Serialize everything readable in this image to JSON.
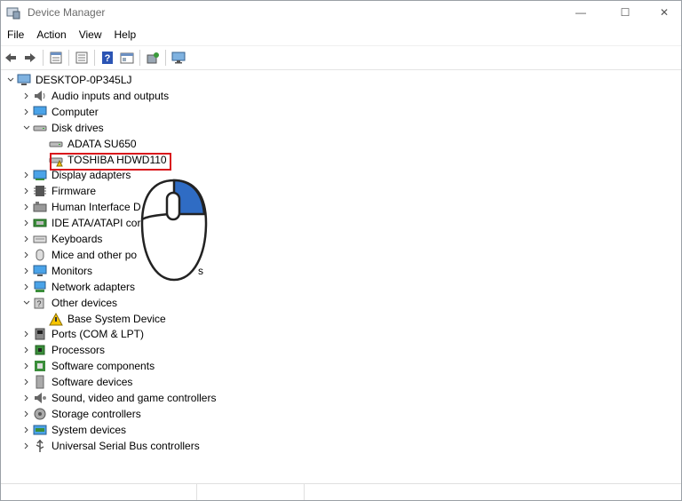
{
  "window": {
    "title": "Device Manager",
    "controls": {
      "minimize": "—",
      "maximize": "☐",
      "close": "✕"
    }
  },
  "menu": [
    {
      "label": "File"
    },
    {
      "label": "Action"
    },
    {
      "label": "View"
    },
    {
      "label": "Help"
    }
  ],
  "toolbar": {
    "buttons": [
      "back-icon",
      "forward-icon",
      "properties-icon",
      "view-icon",
      "help-icon",
      "view-resources-icon",
      "scan-hardware-icon",
      "monitor-icon"
    ]
  },
  "tree": {
    "root": "DESKTOP-0P345LJ",
    "items": [
      {
        "label": "Audio inputs and outputs",
        "icon": "speaker-icon"
      },
      {
        "label": "Computer",
        "icon": "computer-icon"
      },
      {
        "label": "Disk drives",
        "icon": "disk-icon",
        "expanded": true,
        "children": [
          {
            "label": "ADATA SU650",
            "icon": "disk-icon"
          },
          {
            "label": "TOSHIBA HDWD110",
            "icon": "disk-warning-icon",
            "highlighted": true
          }
        ]
      },
      {
        "label": "Display adapters",
        "icon": "display-adapter-icon"
      },
      {
        "label": "Firmware",
        "icon": "firmware-icon"
      },
      {
        "label": "Human Interface D",
        "icon": "hid-icon"
      },
      {
        "label": "IDE ATA/ATAPI cor",
        "icon": "ide-icon"
      },
      {
        "label": "Keyboards",
        "icon": "keyboard-icon"
      },
      {
        "label": "Mice and other po",
        "icon": "mouse-icon"
      },
      {
        "label": "Monitors",
        "icon": "monitor-icon"
      },
      {
        "label": "Network adapters",
        "icon": "network-icon"
      },
      {
        "label": "Other devices",
        "icon": "unknown-device-icon",
        "expanded": true,
        "children": [
          {
            "label": "Base System Device",
            "icon": "device-warning-icon"
          }
        ]
      },
      {
        "label": "Ports (COM & LPT)",
        "icon": "port-icon"
      },
      {
        "label": "Processors",
        "icon": "processor-icon"
      },
      {
        "label": "Software components",
        "icon": "software-component-icon"
      },
      {
        "label": "Software devices",
        "icon": "software-device-icon"
      },
      {
        "label": "Sound, video and game controllers",
        "icon": "sound-icon"
      },
      {
        "label": "Storage controllers",
        "icon": "storage-icon"
      },
      {
        "label": "System devices",
        "icon": "system-icon"
      },
      {
        "label": "Universal Serial Bus controllers",
        "icon": "usb-icon"
      }
    ],
    "trailing_fragment": "s"
  },
  "colors": {
    "highlight": "#d9161c",
    "mouse_button": "#2f6cc4"
  }
}
